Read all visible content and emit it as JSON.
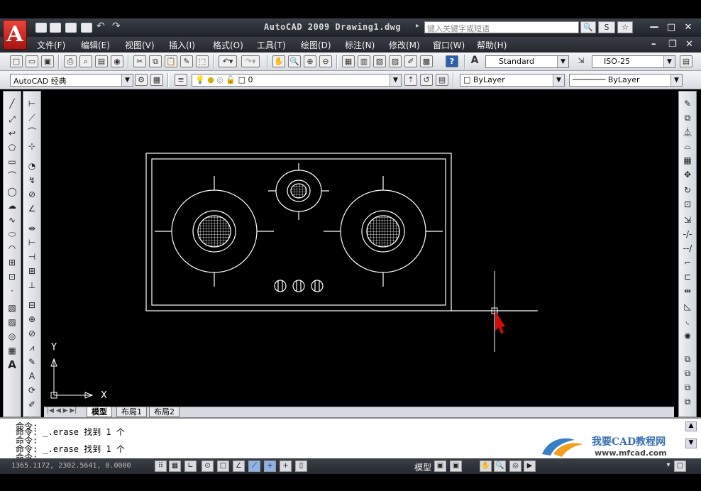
{
  "title": {
    "text": "AutoCAD 2009 Drawing1.dwg",
    "search_placeholder": "键入关键字或短语",
    "app_letter": "A"
  },
  "menu": [
    "文件(F)",
    "编辑(E)",
    "视图(V)",
    "插入(I)",
    "格式(O)",
    "工具(T)",
    "绘图(D)",
    "标注(N)",
    "修改(M)",
    "窗口(W)",
    "帮助(H)"
  ],
  "toolbar": {
    "text_style": "Standard",
    "dim_style": "ISO-25"
  },
  "toolbar2": {
    "workspace": "AutoCAD 经典",
    "layer": "0",
    "color": "ByLayer",
    "linetype": "ByLayer"
  },
  "ucs": {
    "y_label": "Y",
    "x_label": "X"
  },
  "tabs": [
    "模型",
    "布局1",
    "布局2"
  ],
  "command": {
    "lines": [
      "命令:",
      "命令: _.erase 找到 1 个",
      "命令:",
      "命令: _.erase 找到 1 个",
      "命令:"
    ]
  },
  "status": {
    "coords": "1365.1172, 2302.5641, 0.0000",
    "model_label": "模型"
  },
  "watermark": {
    "brand": "我要CAD教程网",
    "url": "www.mfcad.com"
  },
  "colors": {
    "drawing": "#ffffff",
    "background": "#000000",
    "cursor_arrow": "#d01010"
  }
}
